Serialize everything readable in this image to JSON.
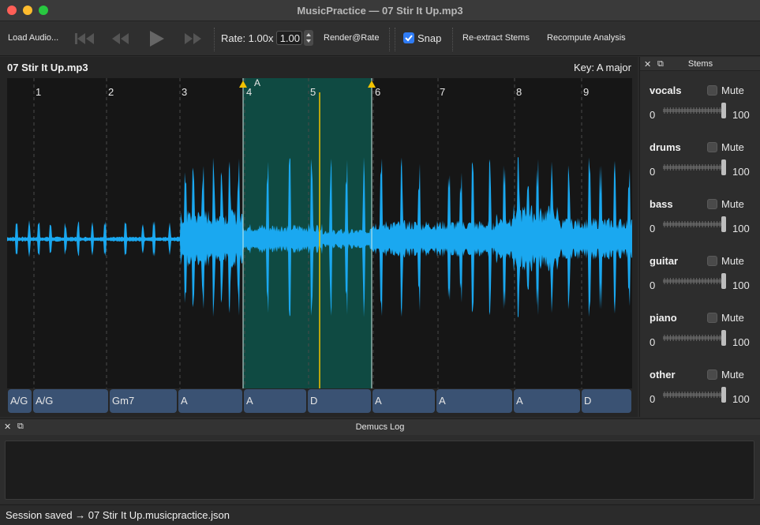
{
  "window": {
    "title": "MusicPractice — 07 Stir It Up.mp3"
  },
  "toolbar": {
    "load_label": "Load Audio...",
    "rate_label": "Rate: 1.00x",
    "rate_value": "1.00",
    "render_label": "Render@Rate",
    "snap_label": "Snap",
    "snap_checked": true,
    "reextract_label": "Re-extract Stems",
    "recompute_label": "Recompute Analysis",
    "transport_icons": [
      "skip-to-start-icon",
      "rewind-icon",
      "play-icon",
      "fast-forward-icon"
    ]
  },
  "waveform": {
    "file_name": "07 Stir It Up.mp3",
    "key_label": "Key: A major",
    "bar_numbers": [
      "1",
      "2",
      "3",
      "4",
      "5",
      "6",
      "7",
      "8",
      "9"
    ],
    "loop_marker_label": "A",
    "colors": {
      "wave": "#1aa8f0",
      "loop": "#0f4a42",
      "playhead": "#f2c200",
      "marker": "#f2c200"
    }
  },
  "chords": [
    "A/G",
    "A/G",
    "Gm7",
    "A",
    "A",
    "D",
    "A",
    "A",
    "A",
    "D"
  ],
  "stems": {
    "title": "Stems",
    "mute_label": "Mute",
    "min_label": "0",
    "max_label": "100",
    "items": [
      {
        "name": "vocals",
        "volume": 100,
        "muted": false
      },
      {
        "name": "drums",
        "volume": 100,
        "muted": false
      },
      {
        "name": "bass",
        "volume": 100,
        "muted": false
      },
      {
        "name": "guitar",
        "volume": 100,
        "muted": false
      },
      {
        "name": "piano",
        "volume": 100,
        "muted": false
      },
      {
        "name": "other",
        "volume": 100,
        "muted": false
      }
    ]
  },
  "log": {
    "title": "Demucs Log",
    "content": ""
  },
  "status": {
    "text": "Session saved → 07 Stir It Up.musicpractice.json"
  }
}
